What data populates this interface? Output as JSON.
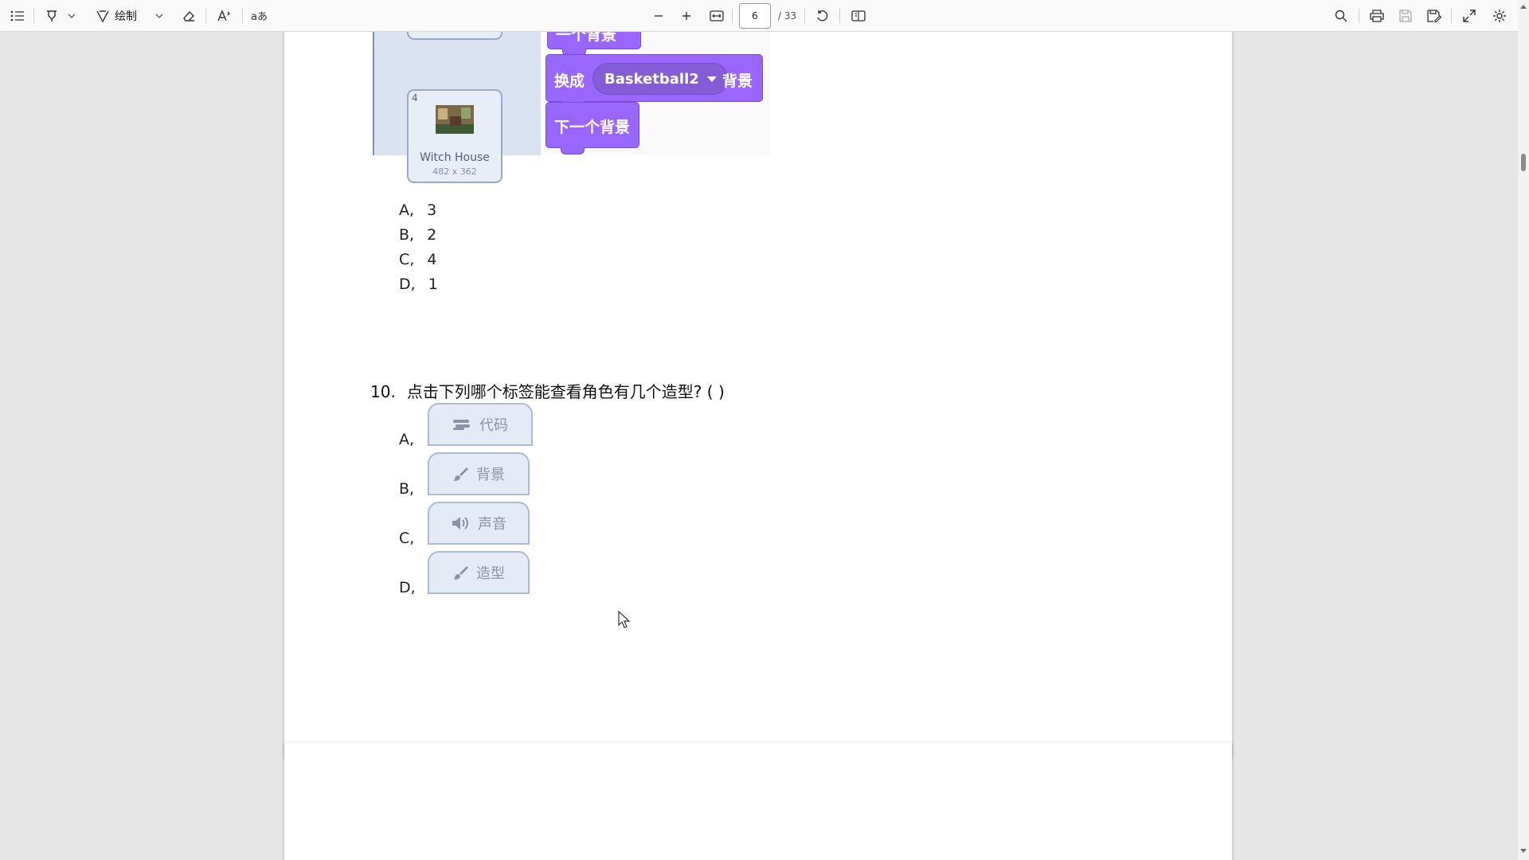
{
  "toolbar": {
    "draw_label": "绘制",
    "current_page": "6",
    "page_total": "/ 33"
  },
  "image": {
    "backdrop_number": "4",
    "backdrop_name": "Witch House",
    "backdrop_size": "482 x 362",
    "top_block_label": "一个背景",
    "switch_prefix": "换成",
    "switch_option": "Basketball2",
    "switch_suffix": "背景",
    "next_block_label": "下一个背景"
  },
  "q9_options": [
    {
      "letter": "A,",
      "value": "3"
    },
    {
      "letter": "B,",
      "value": "2"
    },
    {
      "letter": "C,",
      "value": "4"
    },
    {
      "letter": "D,",
      "value": "1"
    }
  ],
  "q10": {
    "number": "10.",
    "text": "点击下列哪个标签能查看角色有几个造型? ( )",
    "options": [
      {
        "letter": "A,",
        "tab_label": "代码"
      },
      {
        "letter": "B,",
        "tab_label": "背景"
      },
      {
        "letter": "C,",
        "tab_label": "声音"
      },
      {
        "letter": "D,",
        "tab_label": "造型"
      }
    ]
  },
  "icons": {
    "colors": {
      "toolbar_icon": "#333333",
      "scratch_purple": "#9966ff",
      "tab_icon": "#8b93a8"
    }
  }
}
